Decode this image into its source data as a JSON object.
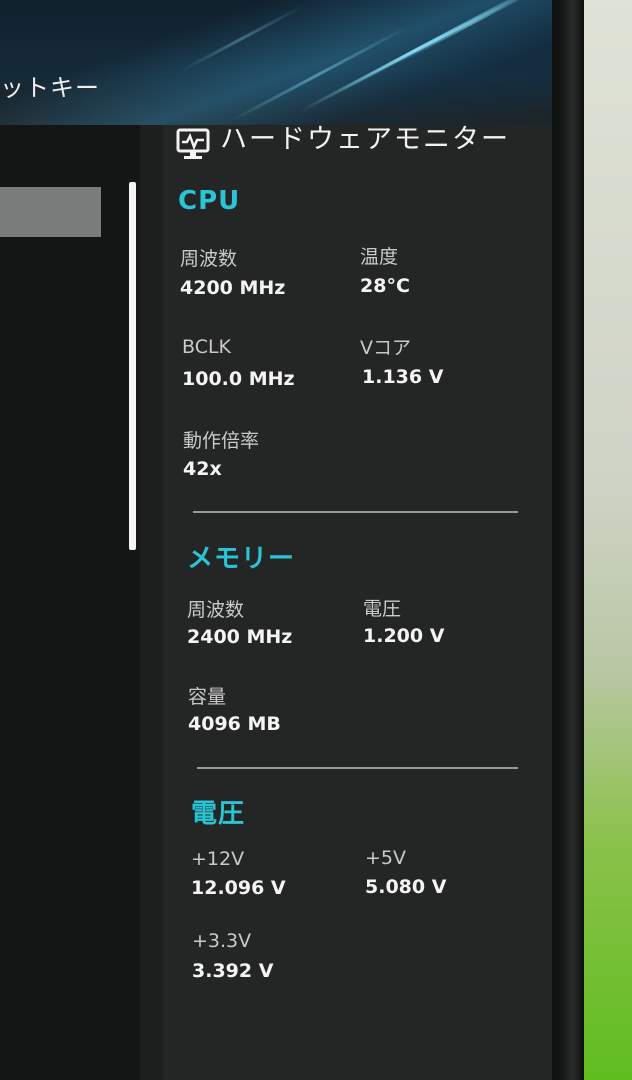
{
  "top_left_label": "ットキー",
  "panel": {
    "title": "ハードウェアモニター",
    "icon": "monitor-icon"
  },
  "cpu": {
    "title": "CPU",
    "freq_label": "周波数",
    "freq_value": "4200 MHz",
    "temp_label": "温度",
    "temp_value": "28°C",
    "bclk_label": "BCLK",
    "bclk_value": "100.0 MHz",
    "vcore_label": "Vコア",
    "vcore_value": "1.136 V",
    "ratio_label": "動作倍率",
    "ratio_value": "42x"
  },
  "memory": {
    "title": "メモリー",
    "freq_label": "周波数",
    "freq_value": "2400 MHz",
    "volt_label": "電圧",
    "volt_value": "1.200 V",
    "capacity_label": "容量",
    "capacity_value": "4096 MB"
  },
  "voltage": {
    "title": "電圧",
    "v12_label": "+12V",
    "v12_value": "12.096 V",
    "v5_label": "+5V",
    "v5_value": "5.080 V",
    "v33_label": "+3.3V",
    "v33_value": "3.392 V"
  },
  "colors": {
    "accent": "#29c5d6",
    "panel_bg": "#242626",
    "selected_item": "#7a7c7c"
  }
}
